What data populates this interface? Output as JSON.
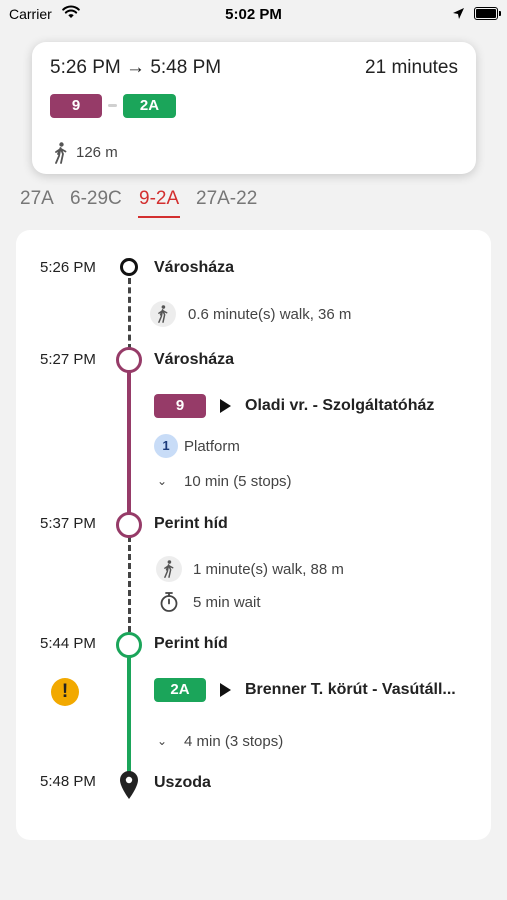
{
  "status_bar": {
    "carrier": "Carrier",
    "time": "5:02 PM"
  },
  "summary": {
    "time_range": "5:26 PM → 5:48 PM",
    "duration": "21 minutes",
    "route_badges": [
      "9",
      "2A"
    ],
    "walk_distance": "126 m"
  },
  "tabs": [
    {
      "label": "27A",
      "active": false
    },
    {
      "label": "6-29C",
      "active": false
    },
    {
      "label": "9-2A",
      "active": true
    },
    {
      "label": "27A-22",
      "active": false
    }
  ],
  "itinerary": {
    "stop1": {
      "time": "5:26 PM",
      "name": "Városháza"
    },
    "walk1": "0.6 minute(s) walk, 36 m",
    "stop2": {
      "time": "5:27 PM",
      "name": "Városháza"
    },
    "leg1": {
      "route": "9",
      "destination": "Oladi vr. - Szolgáltatóház",
      "platform_number": "1",
      "platform_label": "Platform",
      "stops": "10 min (5 stops)"
    },
    "stop3": {
      "time": "5:37 PM",
      "name": "Perint híd"
    },
    "walk2": "1 minute(s) walk, 88 m",
    "wait": "5 min wait",
    "stop4": {
      "time": "5:44 PM",
      "name": "Perint híd"
    },
    "leg2": {
      "route": "2A",
      "destination": "Brenner T. körút  - Vasútáll...",
      "stops": "4 min (3 stops)",
      "alert_icon": "!"
    },
    "stop5": {
      "time": "5:48 PM",
      "name": "Uszoda"
    }
  },
  "colors": {
    "route_9": "#963b68",
    "route_2a": "#1ba55a",
    "active_tab": "#d32f2f",
    "alert": "#f2a900"
  },
  "icons": [
    "wifi-icon",
    "location-arrow-icon",
    "battery-icon",
    "walk-icon",
    "stopwatch-icon",
    "chevron-down-icon",
    "play-arrow-icon",
    "map-pin-icon",
    "alert-icon"
  ]
}
